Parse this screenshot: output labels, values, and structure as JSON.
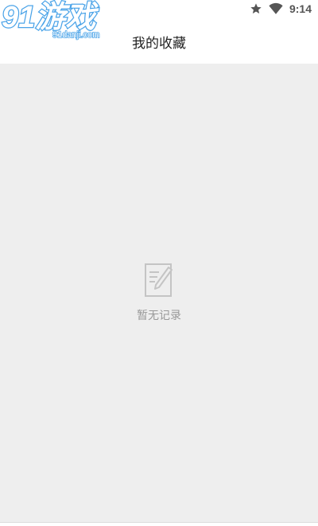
{
  "status_bar": {
    "time": "9:14",
    "icons": [
      "star-icon",
      "wifi-icon"
    ]
  },
  "watermark": {
    "logo_text": "91游戏",
    "url_text": "91danji.com"
  },
  "header": {
    "title": "我的收藏"
  },
  "empty_state": {
    "icon": "note-edit-icon",
    "message": "暂无记录"
  },
  "colors": {
    "background": "#eeeeee",
    "header": "#ffffff",
    "empty_text": "#999999",
    "watermark_blue": "#4aa3e8"
  }
}
